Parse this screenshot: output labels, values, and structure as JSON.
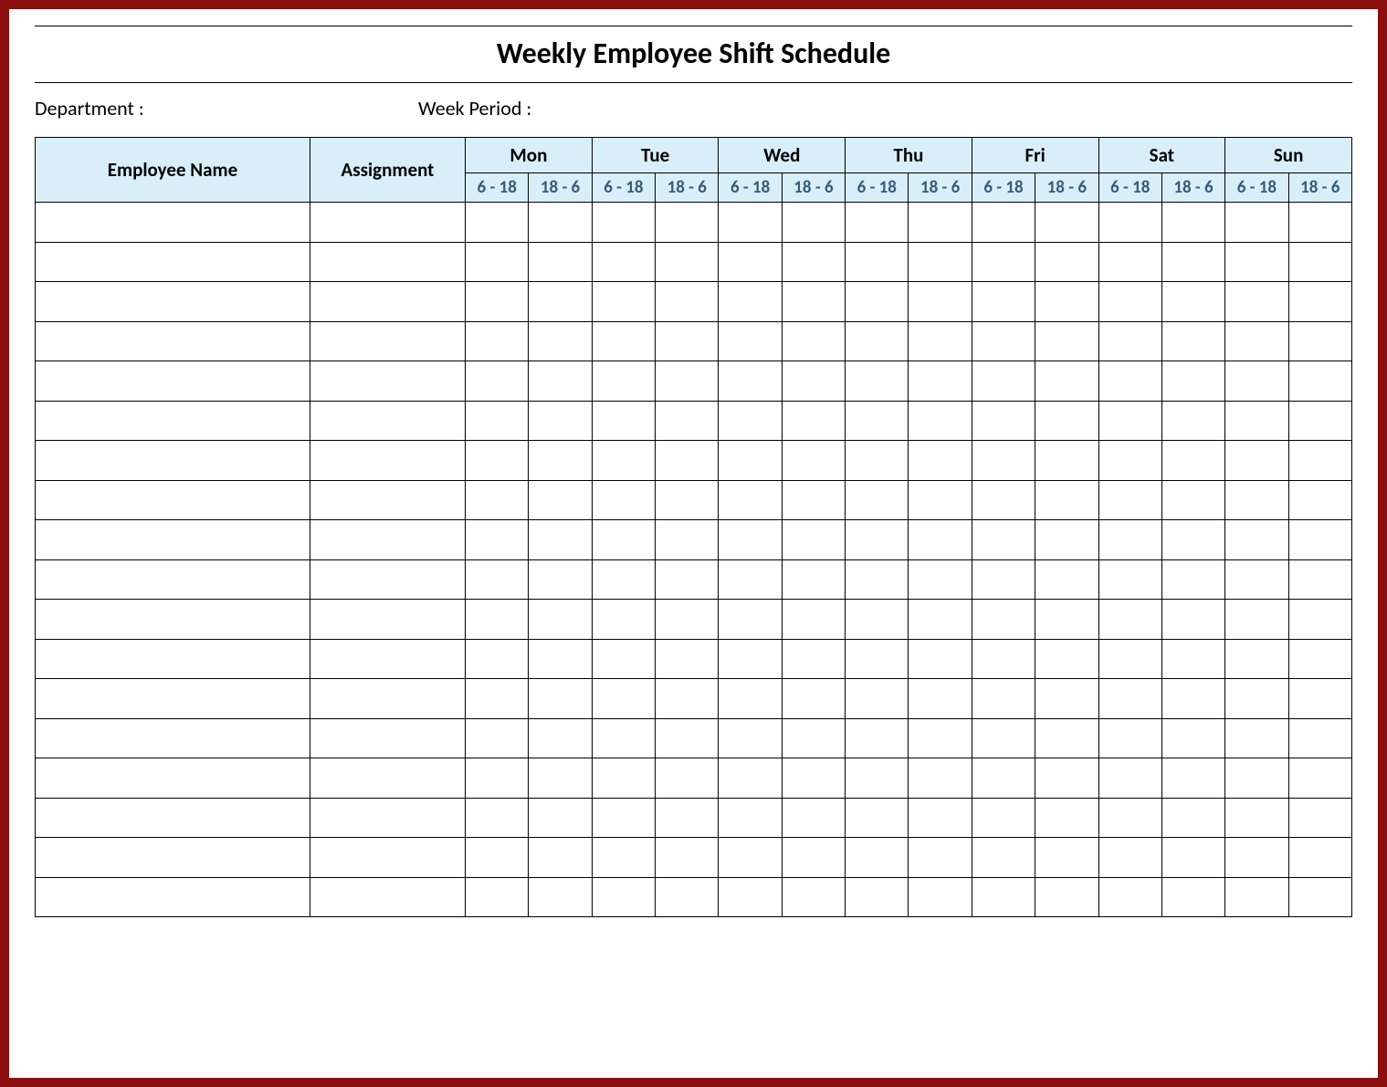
{
  "title": "Weekly Employee Shift Schedule",
  "meta": {
    "department_label": "Department :",
    "week_period_label": "Week  Period :"
  },
  "columns": {
    "employee": "Employee Name",
    "assignment": "Assignment",
    "days": [
      "Mon",
      "Tue",
      "Wed",
      "Thu",
      "Fri",
      "Sat",
      "Sun"
    ],
    "shifts": [
      "6 - 18",
      "18 - 6"
    ]
  },
  "row_count": 18,
  "colors": {
    "border": "#8a0e0e",
    "header_bg": "#d8effa"
  }
}
